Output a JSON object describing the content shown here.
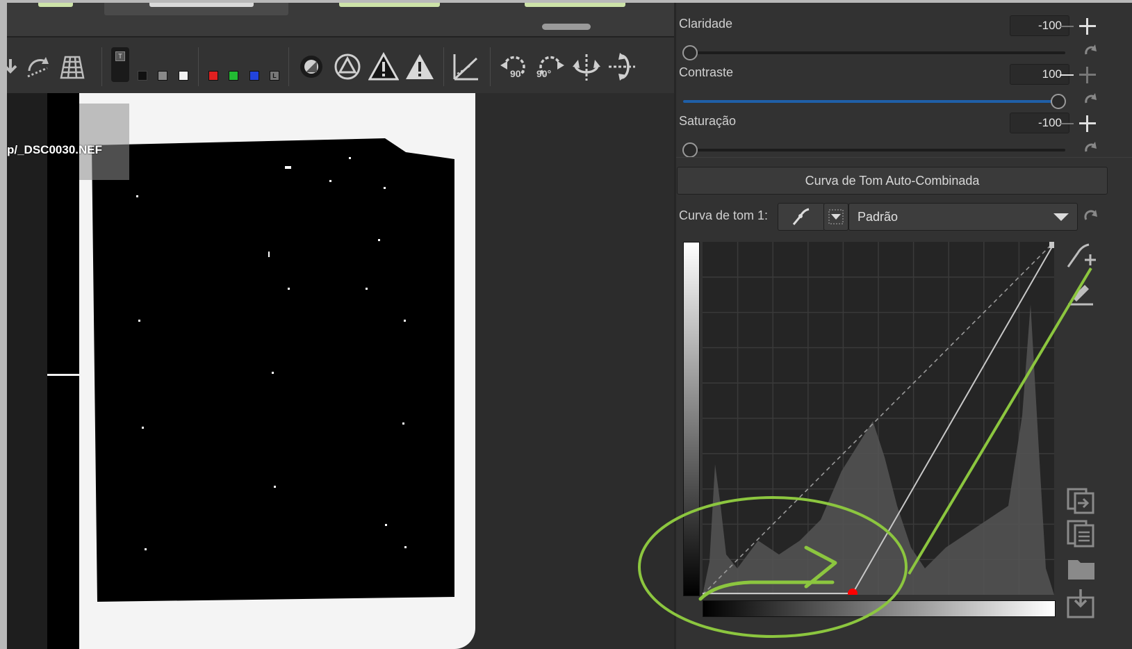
{
  "viewer": {
    "filename": "p/_DSC0030.NEF"
  },
  "toolbar": {
    "icons": [
      "add-to-queue-icon",
      "rotate-crop-icon",
      "grid-overlay-icon",
      "preview-background-icon",
      "black-bg-icon",
      "gray-bg-icon",
      "white-bg-icon",
      "red-channel-icon",
      "green-channel-icon",
      "blue-channel-icon",
      "luminance-channel-icon",
      "focus-mask-icon",
      "warning-shadows-icon",
      "clip-warning-icon",
      "highlight-warning-icon",
      "perspective-icon",
      "rotate-left-icon",
      "rotate-right-icon",
      "flip-vertical-icon",
      "flip-horizontal-icon"
    ],
    "rotate_left_label": "90°",
    "rotate_right_label": "90°",
    "luminance_swatch_label": "L",
    "preview_bg_label": "T"
  },
  "sliders": [
    {
      "label": "Claridade",
      "value": "-100",
      "fraction": 0.0
    },
    {
      "label": "Contraste",
      "value": "100",
      "fraction": 1.0
    },
    {
      "label": "Saturação",
      "value": "-100",
      "fraction": 0.0
    }
  ],
  "curve_section": {
    "auto_button_label": "Curva de Tom Auto-Combinada",
    "curve_label": "Curva de tom 1:",
    "curve_type_value": "Padrão"
  },
  "colors": {
    "accent_green": "#8cc63f",
    "contrast_track": "#1f5fa8",
    "curve_point": "#ff0000"
  }
}
